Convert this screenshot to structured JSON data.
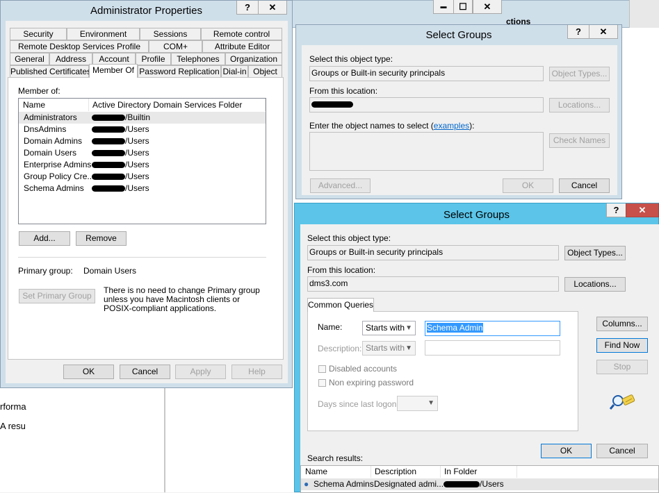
{
  "background": {
    "window_title_fragment": "ctions",
    "side_text": [
      "rforma",
      "A resu"
    ]
  },
  "admin_props": {
    "title": "Administrator Properties",
    "help_glyph": "?",
    "close_glyph": "✕",
    "tabs_row1": [
      "Security",
      "Environment",
      "Sessions",
      "Remote control"
    ],
    "tabs_row2": [
      "Remote Desktop Services Profile",
      "COM+",
      "Attribute Editor"
    ],
    "tabs_row3": [
      "General",
      "Address",
      "Account",
      "Profile",
      "Telephones",
      "Organization"
    ],
    "tabs_row4": [
      "Published Certificates",
      "Member Of",
      "Password Replication",
      "Dial-in",
      "Object"
    ],
    "member_of_label": "Member of:",
    "columns": [
      "Name",
      "Active Directory Domain Services Folder"
    ],
    "rows": [
      {
        "name": "Administrators",
        "folder": "/Builtin"
      },
      {
        "name": "DnsAdmins",
        "folder": "/Users"
      },
      {
        "name": "Domain Admins",
        "folder": "/Users"
      },
      {
        "name": "Domain Users",
        "folder": "/Users"
      },
      {
        "name": "Enterprise Admins",
        "folder": "/Users"
      },
      {
        "name": "Group Policy Cre...",
        "folder": "/Users"
      },
      {
        "name": "Schema Admins",
        "folder": "/Users"
      }
    ],
    "add_button": "Add...",
    "remove_button": "Remove",
    "primary_group_label": "Primary group:",
    "primary_group_value": "Domain Users",
    "set_primary_button": "Set Primary Group",
    "primary_note": "There is no need to change Primary group unless you have Macintosh clients or POSIX-compliant applications.",
    "ok": "OK",
    "cancel": "Cancel",
    "apply": "Apply",
    "help": "Help"
  },
  "mid_window": {
    "minimize_glyph": "▬",
    "maximize_glyph": "☐",
    "close_glyph": "✕"
  },
  "select_groups_back": {
    "title": "Select Groups",
    "help_glyph": "?",
    "close_glyph": "✕",
    "object_type_label": "Select this object type:",
    "object_type_value": "Groups or Built-in security principals",
    "object_types_button": "Object Types...",
    "location_label": "From this location:",
    "locations_button": "Locations...",
    "enter_names_label_pre": "Enter the object names to select (",
    "examples_link": "examples",
    "enter_names_label_post": "):",
    "check_names_button": "Check Names",
    "advanced_button": "Advanced...",
    "ok": "OK",
    "cancel": "Cancel"
  },
  "select_groups_front": {
    "title": "Select Groups",
    "help_glyph": "?",
    "close_glyph": "✕",
    "object_type_label": "Select this object type:",
    "object_type_value": "Groups or Built-in security principals",
    "object_types_button": "Object Types...",
    "location_label": "From this location:",
    "location_value": "dms3.com",
    "locations_button": "Locations...",
    "tab_common_queries": "Common Queries",
    "name_label": "Name:",
    "name_mode": "Starts with",
    "name_value": "Schema Admin",
    "description_label": "Description:",
    "description_mode": "Starts with",
    "disabled_accounts": "Disabled accounts",
    "non_expiring_password": "Non expiring password",
    "days_since_logon": "Days since last logon:",
    "columns_button": "Columns...",
    "find_now_button": "Find Now",
    "stop_button": "Stop",
    "ok": "OK",
    "cancel": "Cancel",
    "search_results_label": "Search results:",
    "result_columns": [
      "Name",
      "Description",
      "In Folder"
    ],
    "results": [
      {
        "name": "Schema Admins",
        "description": "Designated admi...",
        "folder": "/Users"
      }
    ]
  },
  "colors": {
    "active_title": "#5bc4e8",
    "inactive_title": "#cfdfea",
    "close_red": "#c7504a",
    "selection": "#3399ff"
  }
}
